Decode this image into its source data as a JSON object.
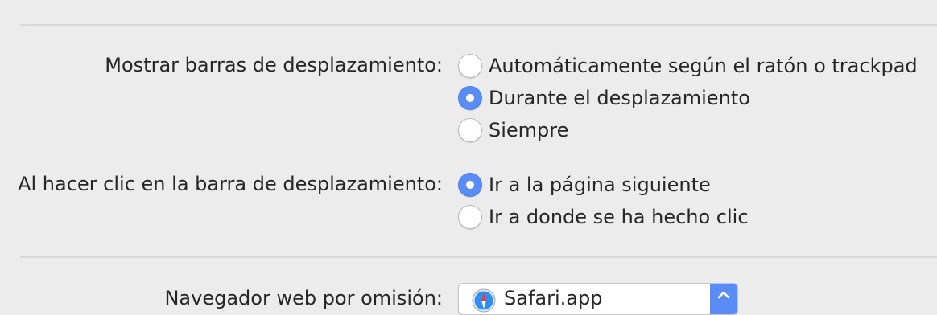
{
  "scroll_bars": {
    "label": "Mostrar barras de desplazamiento:",
    "options": [
      {
        "label": "Automáticamente según el ratón o trackpad",
        "checked": false
      },
      {
        "label": "Durante el desplazamiento",
        "checked": true
      },
      {
        "label": "Siempre",
        "checked": false
      }
    ]
  },
  "scrollbar_click": {
    "label": "Al hacer clic en la barra de desplazamiento:",
    "options": [
      {
        "label": "Ir a la página siguiente",
        "checked": true
      },
      {
        "label": "Ir a donde se ha hecho clic",
        "checked": false
      }
    ]
  },
  "default_browser": {
    "label": "Navegador web por omisión:",
    "selected": "Safari.app",
    "icon": "safari-compass-icon"
  },
  "colors": {
    "accent": "#5a8cf6",
    "background": "#ececec"
  }
}
